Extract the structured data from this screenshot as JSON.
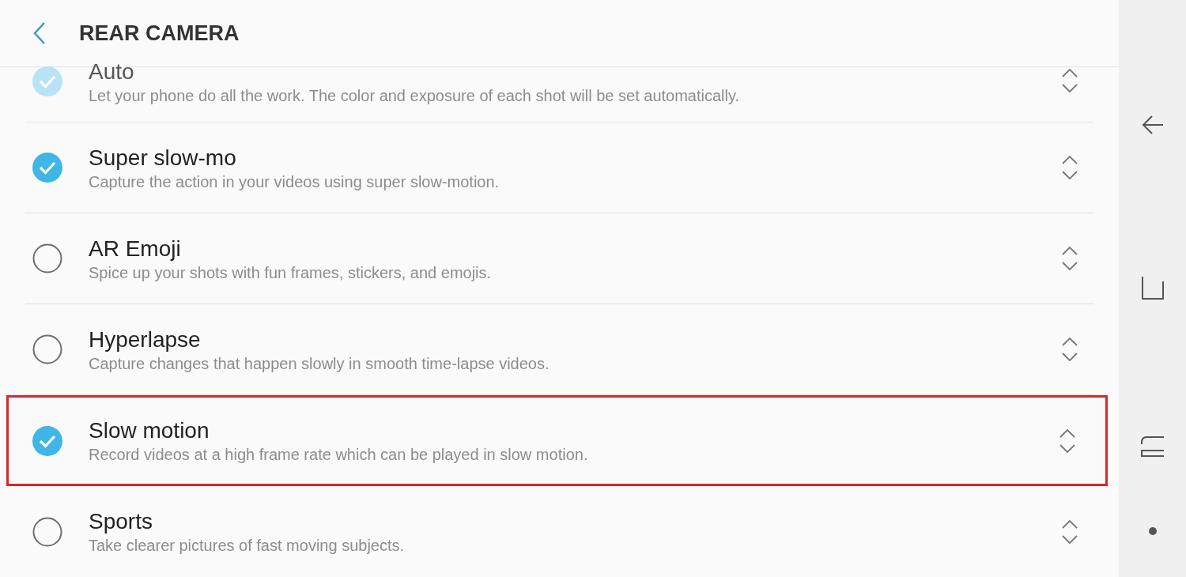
{
  "header": {
    "title": "REAR CAMERA"
  },
  "modes": [
    {
      "name": "Auto",
      "description": "Let your phone do all the work. The color and exposure of each shot will be set automatically.",
      "checked": true,
      "disabled": true,
      "highlighted": false
    },
    {
      "name": "Super slow-mo",
      "description": "Capture the action in your videos using super slow-motion.",
      "checked": true,
      "disabled": false,
      "highlighted": false
    },
    {
      "name": "AR Emoji",
      "description": "Spice up your shots with fun frames, stickers, and emojis.",
      "checked": false,
      "disabled": false,
      "highlighted": false
    },
    {
      "name": "Hyperlapse",
      "description": "Capture changes that happen slowly in smooth time-lapse videos.",
      "checked": false,
      "disabled": false,
      "highlighted": false
    },
    {
      "name": "Slow motion",
      "description": "Record videos at a high frame rate which can be played in slow motion.",
      "checked": true,
      "disabled": false,
      "highlighted": true
    },
    {
      "name": "Sports",
      "description": "Take clearer pictures of fast moving subjects.",
      "checked": false,
      "disabled": false,
      "highlighted": false
    }
  ]
}
